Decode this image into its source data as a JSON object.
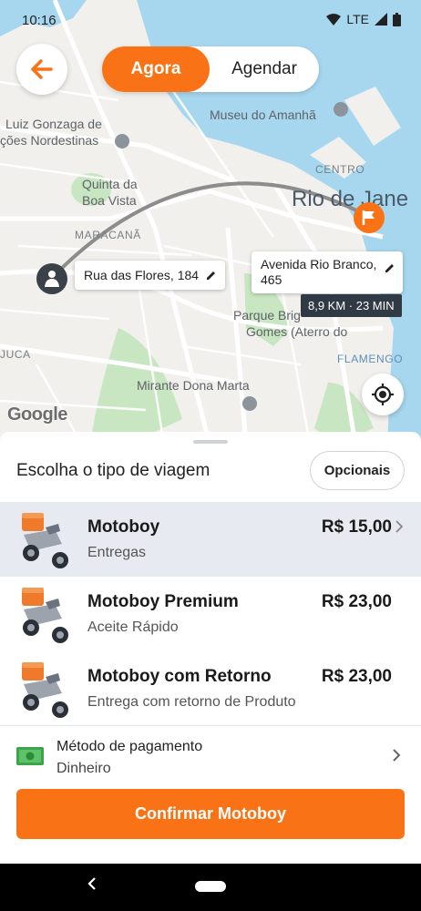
{
  "status_bar": {
    "time": "10:16",
    "network": "LTE"
  },
  "header": {
    "mode_now": "Agora",
    "mode_schedule": "Agendar"
  },
  "map": {
    "labels": {
      "museu": "Museu do Amanhã",
      "luiz_1": "Luiz Gonzaga de",
      "luiz_2": "ções Nordestinas",
      "centro": "CENTRO",
      "quinta_1": "Quinta da",
      "quinta_2": "Boa Vista",
      "rio": "Rio de Jane",
      "maracana": "MARACANÃ",
      "parque_1": "Parque Brig",
      "parque_2": "Gomes (Aterro do",
      "juca": "JUCA",
      "flamengo": "FLAMENGO",
      "mirante": "Mirante Dona Marta"
    },
    "origin_address": "Rua das Flores, 184",
    "destination_address": "Avenida Rio Branco, 465",
    "route_info": "8,9 KM · 23 MIN",
    "attribution": "Google"
  },
  "sheet": {
    "title": "Escolha o tipo de viagem",
    "options_label": "Opcionais",
    "rides": [
      {
        "name": "Motoboy",
        "description": "Entregas",
        "price": "R$ 15,00",
        "selected": true
      },
      {
        "name": "Motoboy Premium",
        "description": "Aceite Rápido",
        "price": "R$ 23,00",
        "selected": false
      },
      {
        "name": "Motoboy com Retorno",
        "description": "Entrega com retorno de Produto",
        "price": "R$ 23,00",
        "selected": false
      }
    ],
    "payment": {
      "title": "Método de pagamento",
      "value": "Dinheiro",
      "icon": "cash-icon"
    },
    "confirm_label": "Confirmar Motoboy"
  },
  "colors": {
    "accent": "#f97316",
    "selected_row": "#e7eaf1",
    "water": "#a6d7ef",
    "park": "#c8e6c1"
  }
}
